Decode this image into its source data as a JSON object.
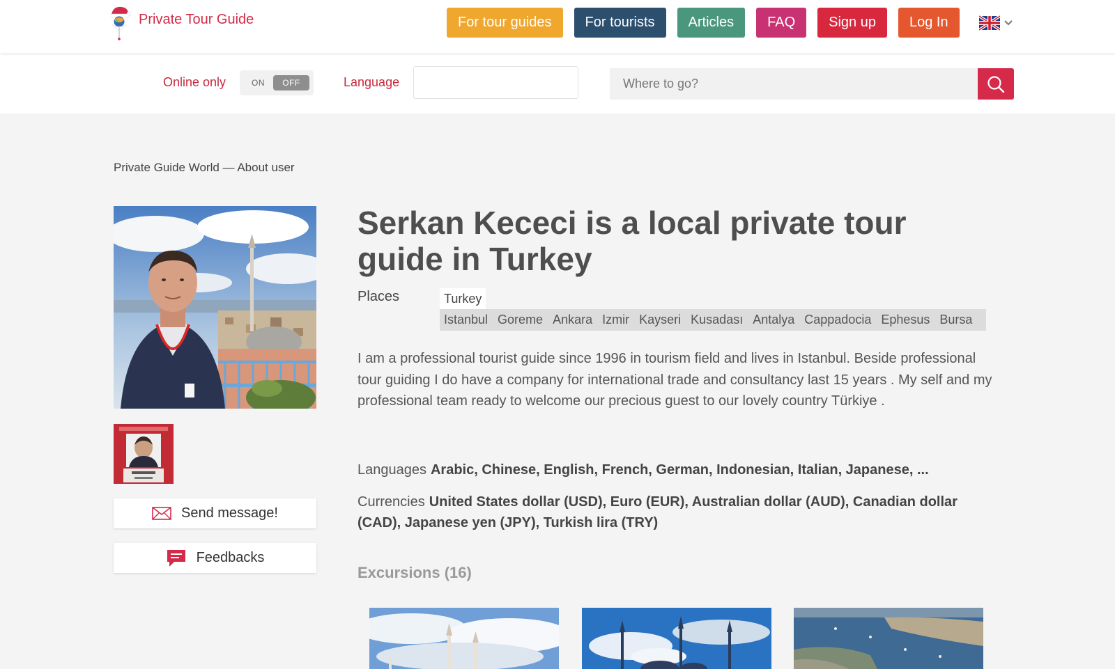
{
  "brand": {
    "name": "Private Tour Guide"
  },
  "nav": [
    {
      "label": "For tour guides",
      "color": "#f0a72e"
    },
    {
      "label": "For tourists",
      "color": "#2c4f6e"
    },
    {
      "label": "Articles",
      "color": "#4a977d"
    },
    {
      "label": "FAQ",
      "color": "#c93272"
    },
    {
      "label": "Sign up",
      "color": "#d8283e"
    },
    {
      "label": "Log In",
      "color": "#e5582f"
    }
  ],
  "filters": {
    "online_label": "Online only",
    "toggle_on": "ON",
    "toggle_off": "OFF",
    "language_label": "Language",
    "language_value": "",
    "search_placeholder": "Where to go?"
  },
  "breadcrumb": {
    "home": "Private Guide World",
    "separator": "—",
    "current": "About user"
  },
  "profile": {
    "title": "Serkan Kececi is a local private tour guide in Turkey",
    "places_label": "Places",
    "country": "Turkey",
    "cities": [
      "Istanbul",
      "Goreme",
      "Ankara",
      "Izmir",
      "Kayseri",
      "Kusadası",
      "Antalya",
      "Cappadocia",
      "Ephesus",
      "Bursa"
    ],
    "bio": "I am a professional tourist guide since 1996 in tourism field and lives in Istanbul. Beside professional tour guiding I do have a company for international trade and consultancy last 15 years . My self and my professional team ready to welcome our precious guest to our lovely country Türkiye .",
    "languages_label": "Languages",
    "languages": "Arabic, Chinese, English, French, German, Indonesian, Italian, Japanese, ...",
    "currencies_label": "Currencies",
    "currencies": "United States dollar (USD), Euro (EUR), Australian dollar (AUD), Canadian dollar (CAD), Japanese yen (JPY), Turkish lira (TRY)"
  },
  "actions": {
    "send_message": "Send message!",
    "feedbacks": "Feedbacks"
  },
  "excursions": {
    "title": "Excursions (16)"
  },
  "colors": {
    "accent": "#d52a4a"
  }
}
